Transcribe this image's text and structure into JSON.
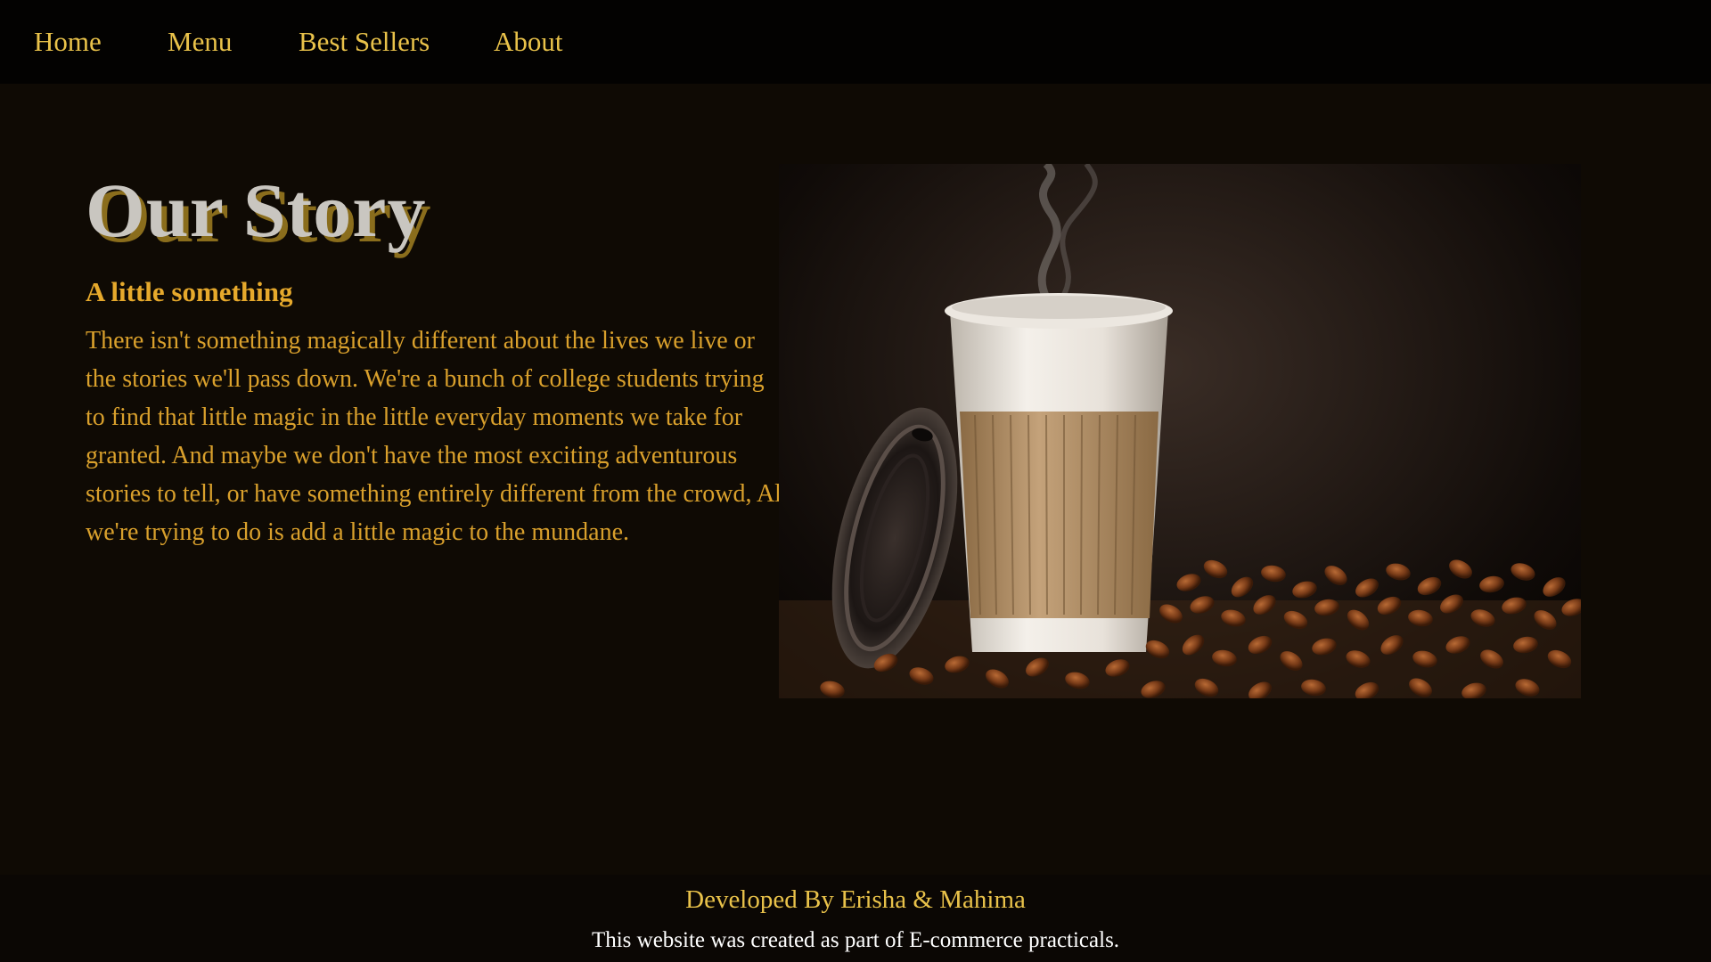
{
  "nav": {
    "items": [
      {
        "label": "Home"
      },
      {
        "label": "Menu"
      },
      {
        "label": "Best Sellers"
      },
      {
        "label": "About"
      }
    ]
  },
  "story": {
    "title": "Our Story",
    "subtitle": "A little something",
    "body": "There isn't something magically different about the lives we live or the stories we'll pass down. We're a bunch of college students trying to find that little magic in the little everyday moments we take for granted. And maybe we don't have the most exciting adventurous stories to tell, or have something entirely different from the crowd, All we're trying to do is add a little magic to the mundane."
  },
  "hero": {
    "image_subject": "coffee-cup-with-beans"
  },
  "footer": {
    "credit": "Developed By Erisha & Mahima",
    "note": "This website was created as part of E-commerce practicals."
  },
  "colors": {
    "page_bg": "#0f0a04",
    "nav_bg": "#030201",
    "accent_gold": "#e9c24a",
    "text_amber": "#d9a02c",
    "title_silver": "#c9c6c0",
    "title_shadow": "#8a6d1c"
  }
}
